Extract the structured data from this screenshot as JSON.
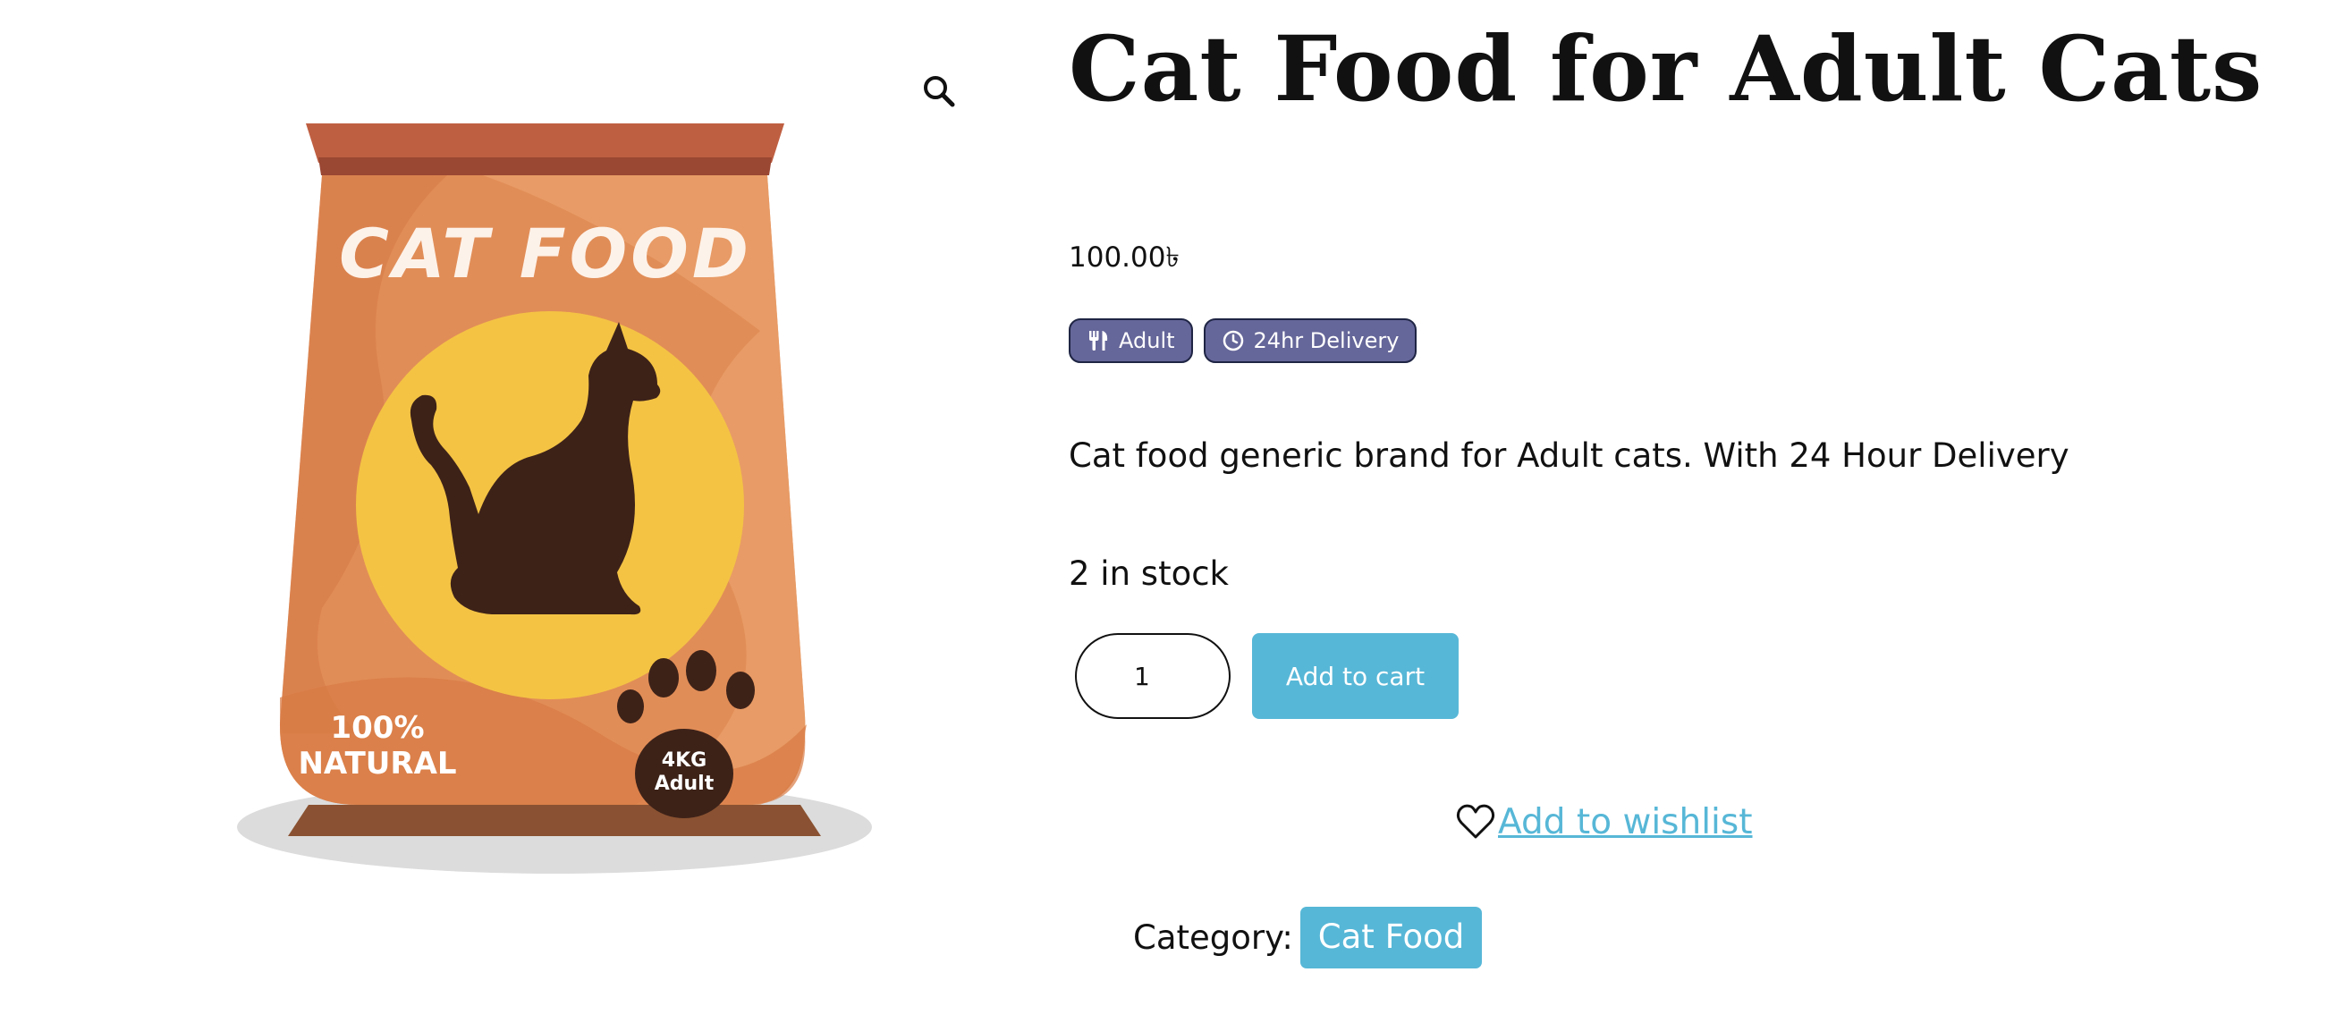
{
  "product": {
    "title": "Cat Food for Adult Cats",
    "price": "100.00৳",
    "badges": [
      {
        "icon": "fork-knife-icon",
        "label": "Adult"
      },
      {
        "icon": "clock-icon",
        "label": "24hr Delivery"
      }
    ],
    "description": "Cat food generic brand for Adult cats. With 24 Hour Delivery",
    "stock": "2 in stock",
    "quantity": "1",
    "add_to_cart_label": "Add to cart",
    "wishlist_label": " Add to wishlist",
    "category_label": "Category:",
    "category": "Cat Food"
  },
  "image": {
    "bag_text": "CAT FOOD",
    "natural_line1": "100%",
    "natural_line2": "NATURAL",
    "weight": "4KG",
    "variant": "Adult",
    "icons": {
      "zoom": "magnifier-icon"
    }
  },
  "colors": {
    "badge_bg": "#656699",
    "accent": "#57b7d7",
    "bag_main": "#e38b55",
    "bag_top": "#b95a3f",
    "circle": "#f4c344",
    "silhouette": "#3d2218"
  }
}
